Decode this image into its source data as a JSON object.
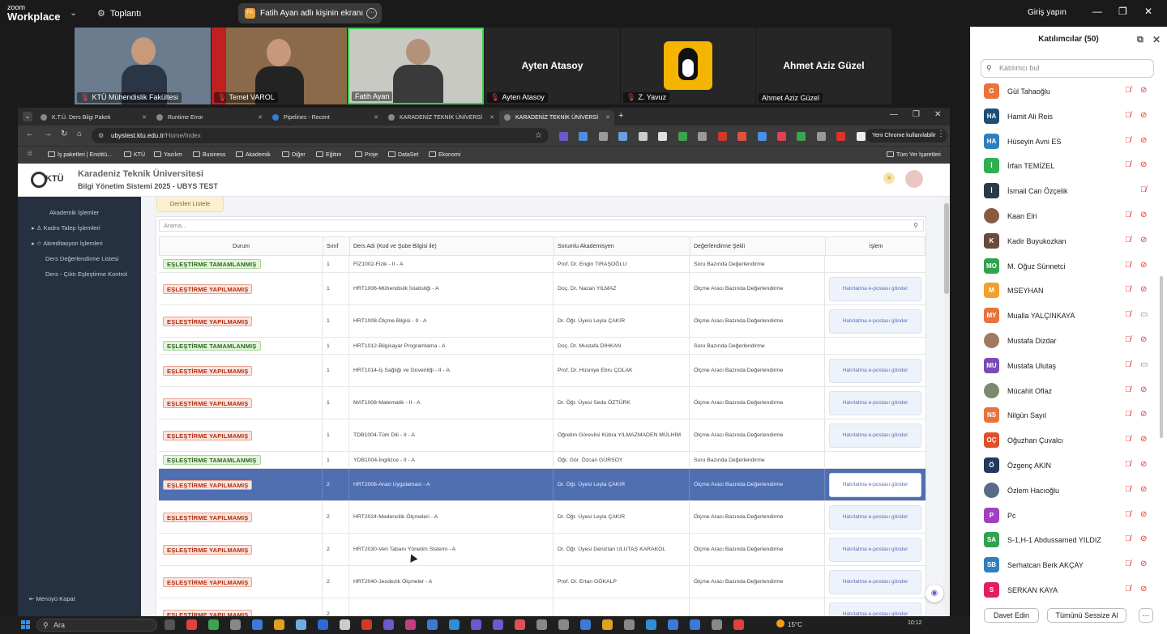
{
  "zoom": {
    "logo_top": "zoom",
    "logo_bottom": "Workplace",
    "meeting_label": "Toplantı",
    "share_label": "Fatih Ayan adlı kişinin ekranı",
    "share_icon_text": "FA",
    "login": "Giriş yapın"
  },
  "video_tiles": [
    {
      "name": "KTÜ Mühendislik Fakültesi",
      "bg": "#6b7c8f"
    },
    {
      "name": "Temel VAROL",
      "bg": "#8a6a4a"
    },
    {
      "name": "Fatih Ayan",
      "bg": "#c9c9c4"
    },
    {
      "name": "Ayten Atasoy",
      "display": "Ayten Atasoy",
      "bg": "#262626"
    },
    {
      "name": "Z. Yavuz",
      "bg": "#262626"
    },
    {
      "name": "Ahmet Aziz Güzel",
      "display": "Ahmet Aziz Güzel",
      "bg": "#262626"
    }
  ],
  "browser": {
    "tabs": [
      {
        "label": "K.T.Ü. Ders Bilgi Paketi",
        "active": false
      },
      {
        "label": "Runtime Error",
        "active": false
      },
      {
        "label": "Pipelines - Recent",
        "active": false
      },
      {
        "label": "KARADENİZ TEKNİK ÜNİVERSİ",
        "active": false
      },
      {
        "label": "KARADENİZ TEKNİK ÜNİVERSİ",
        "active": true
      }
    ],
    "url_host": "ubystest.ktu.edu.tr",
    "url_path": "/Home/Index",
    "profile_label": "Yeni Chrome kullanılabilir",
    "bookmarks": [
      "İş paketleri | Enstitü...",
      "KTÜ",
      "Yazılım",
      "Business",
      "Akademik",
      "Diğer",
      "Eğitim",
      "Proje",
      "DataSet",
      "Ekonomi"
    ],
    "all_bookmarks": "Tüm Yer İşaretleri"
  },
  "ubys": {
    "logo": "KTÜ",
    "title": "Karadeniz Teknik Üniversitesi",
    "subtitle": "Bilgi Yönetim Sistemi 2025 - UBYS TEST",
    "sidebar": [
      {
        "label": "Akademik İşlemler"
      },
      {
        "label": "Kadro Talep İşlemleri"
      },
      {
        "label": "Akreditasyon İşlemleri"
      },
      {
        "label": "Ders Değerlendirme Listesi"
      },
      {
        "label": "Ders - Çıktı Eşleştirme Kontrol"
      }
    ],
    "close_menu": "Menüyü Kapat",
    "list_button": "Dersleri Listele",
    "search_placeholder": "Arama...",
    "columns": [
      "Durum",
      "Sınıf",
      "Ders Adı (Kod ve Şube Bilgisi ile)",
      "Sorumlu Akademisyen",
      "Değerlendirme Şekli",
      "İşlem"
    ],
    "remind_label": "Hatırlatma e-postası gönder",
    "rows": [
      {
        "status": "EŞLEŞTİRME TAMAMLANMIŞ",
        "ok": true,
        "cls": "1",
        "course": "FİZ1002-Fizik - II - A",
        "teacher": "Prof. Dr. Engin TIRAŞOĞLU",
        "method": "Soru Bazında Değerlendirme",
        "remind": false
      },
      {
        "status": "EŞLEŞTİRME YAPILMAMIŞ",
        "ok": false,
        "cls": "1",
        "course": "HRT1006-Mühendislik İstatistiği - A",
        "teacher": "Doç. Dr. Nazan YILMAZ",
        "method": "Ölçme Aracı Bazında Değerlendirme",
        "remind": true
      },
      {
        "status": "EŞLEŞTİRME YAPILMAMIŞ",
        "ok": false,
        "cls": "1",
        "course": "HRT1008-Ölçme Bilgisi - II - A",
        "teacher": "Dr. Öğr. Üyesi Leyla ÇAKIR",
        "method": "Ölçme Aracı Bazında Değerlendirme",
        "remind": true
      },
      {
        "status": "EŞLEŞTİRME TAMAMLANMIŞ",
        "ok": true,
        "cls": "1",
        "course": "HRT1012-Bilgisayar Programlama - A",
        "teacher": "Doç. Dr. Mustafa DİHKAN",
        "method": "Soru Bazında Değerlendirme",
        "remind": false
      },
      {
        "status": "EŞLEŞTİRME YAPILMAMIŞ",
        "ok": false,
        "cls": "1",
        "course": "HRT1014-İş Sağlığı ve Güvenliği - II - A",
        "teacher": "Prof. Dr. Hüsniye Ebru ÇOLAK",
        "method": "Ölçme Aracı Bazında Değerlendirme",
        "remind": true
      },
      {
        "status": "EŞLEŞTİRME YAPILMAMIŞ",
        "ok": false,
        "cls": "1",
        "course": "MAT1008-Matematik - II - A",
        "teacher": "Dr. Öğr. Üyesi Seda ÖZTÜRK",
        "method": "Ölçme Aracı Bazında Değerlendirme",
        "remind": true
      },
      {
        "status": "EŞLEŞTİRME YAPILMAMIŞ",
        "ok": false,
        "cls": "1",
        "course": "TDB1004-Türk Dili - II - A",
        "teacher": "Öğretim Görevlisi Kübra YILMAZMADEN MÜLHİM",
        "method": "Ölçme Aracı Bazında Değerlendirme",
        "remind": true
      },
      {
        "status": "EŞLEŞTİRME TAMAMLANMIŞ",
        "ok": true,
        "cls": "1",
        "course": "YDB1004-İngilizce - II - A",
        "teacher": "Öğr. Gör. Özcan GÜRSOY",
        "method": "Soru Bazında Değerlendirme",
        "remind": false
      },
      {
        "status": "EŞLEŞTİRME YAPILMAMIŞ",
        "ok": false,
        "cls": "2",
        "course": "HRT2008-Arazi Uygulaması - A",
        "teacher": "Dr. Öğr. Üyesi Leyla ÇAKIR",
        "method": "Ölçme Aracı Bazında Değerlendirme",
        "remind": true,
        "selected": true
      },
      {
        "status": "EŞLEŞTİRME YAPILMAMIŞ",
        "ok": false,
        "cls": "2",
        "course": "HRT2024-Mədencilik Ölçmeleri - A",
        "teacher": "Dr. Öğr. Üyesi Leyla ÇAKIR",
        "method": "Ölçme Aracı Bazında Değerlendirme",
        "remind": true
      },
      {
        "status": "EŞLEŞTİRME YAPILMAMIŞ",
        "ok": false,
        "cls": "2",
        "course": "HRT2030-Veri Tabanı Yönetim Sistemi - A",
        "teacher": "Dr. Öğr. Üyesi Deniztan ULUTAŞ KARAKOL",
        "method": "Ölçme Aracı Bazında Değerlendirme",
        "remind": true
      },
      {
        "status": "EŞLEŞTİRME YAPILMAMIŞ",
        "ok": false,
        "cls": "2",
        "course": "HRT2040-Jeodezik Ölçmeler - A",
        "teacher": "Prof. Dr. Ertan GÖKALP",
        "method": "Ölçme Aracı Bazında Değerlendirme",
        "remind": true
      },
      {
        "status": "EŞLEŞTİRME YAPILMAMIŞ",
        "ok": false,
        "cls": "2",
        "course": "",
        "teacher": "",
        "method": "",
        "remind": true
      }
    ]
  },
  "participants": {
    "title": "Katılımcılar (50)",
    "search_placeholder": "Katılımcı bul",
    "invite": "Davet Edin",
    "mute_all": "Tümünü Sessize Al",
    "more": "···",
    "list": [
      {
        "name": "Gül Tahaoğlu",
        "initials": "G",
        "color": "#e8743b",
        "cam": "off"
      },
      {
        "name": "Hamit Ali Reis",
        "initials": "HA",
        "color": "#1f4e79",
        "cam": "off"
      },
      {
        "name": "Hüseyin Avni ES",
        "initials": "HA",
        "color": "#2f7fbf",
        "cam": "off"
      },
      {
        "name": "İrfan TEMİZEL",
        "initials": "İ",
        "color": "#2faf4f",
        "cam": "off"
      },
      {
        "name": "İsmail Can Özçelik",
        "initials": "İ",
        "color": "#2b3a4a",
        "cam": "none"
      },
      {
        "name": "Kaan Elri",
        "initials": "",
        "color": "#8a5a40",
        "cam": "off"
      },
      {
        "name": "Kadir Buyukozkan",
        "initials": "K",
        "color": "#6b4a3a",
        "cam": "off"
      },
      {
        "name": "M. Oğuz Sünnetci",
        "initials": "MO",
        "color": "#2fa34f",
        "cam": "off"
      },
      {
        "name": "MSEYHAN",
        "initials": "M",
        "color": "#f0a030",
        "cam": "off"
      },
      {
        "name": "Mualla YALÇINKAYA",
        "initials": "MY",
        "color": "#e8743b",
        "cam": "on"
      },
      {
        "name": "Mustafa Dizdar",
        "initials": "",
        "color": "#a07a60",
        "cam": "off"
      },
      {
        "name": "Mustafa Ulutaş",
        "initials": "MU",
        "color": "#7a4ab8",
        "cam": "on"
      },
      {
        "name": "Mücahit Oflaz",
        "initials": "",
        "color": "#7a8a6a",
        "cam": "off"
      },
      {
        "name": "Nilgün Sayıl",
        "initials": "NS",
        "color": "#e8743b",
        "cam": "off"
      },
      {
        "name": "Oğuzhan Çuvalcı",
        "initials": "OÇ",
        "color": "#e0502a",
        "cam": "off"
      },
      {
        "name": "Özgenç AKIN",
        "initials": "Ö",
        "color": "#1f3a5a",
        "cam": "off"
      },
      {
        "name": "Özlem Hacıoğlu",
        "initials": "",
        "color": "#5a6a8a",
        "cam": "off"
      },
      {
        "name": "Pc",
        "initials": "P",
        "color": "#a040c0",
        "cam": "off"
      },
      {
        "name": "S-1,H-1 Abdussamed YILDIZ",
        "initials": "SA",
        "color": "#2fa34f",
        "cam": "off"
      },
      {
        "name": "Serhatcan Berk AKÇAY",
        "initials": "SB",
        "color": "#2f7fbf",
        "cam": "off"
      },
      {
        "name": "SERKAN KAYA",
        "initials": "S",
        "color": "#e0205a",
        "cam": "off"
      }
    ]
  },
  "taskbar": {
    "search": "Ara",
    "weather": "15°C",
    "time": "10:12"
  }
}
